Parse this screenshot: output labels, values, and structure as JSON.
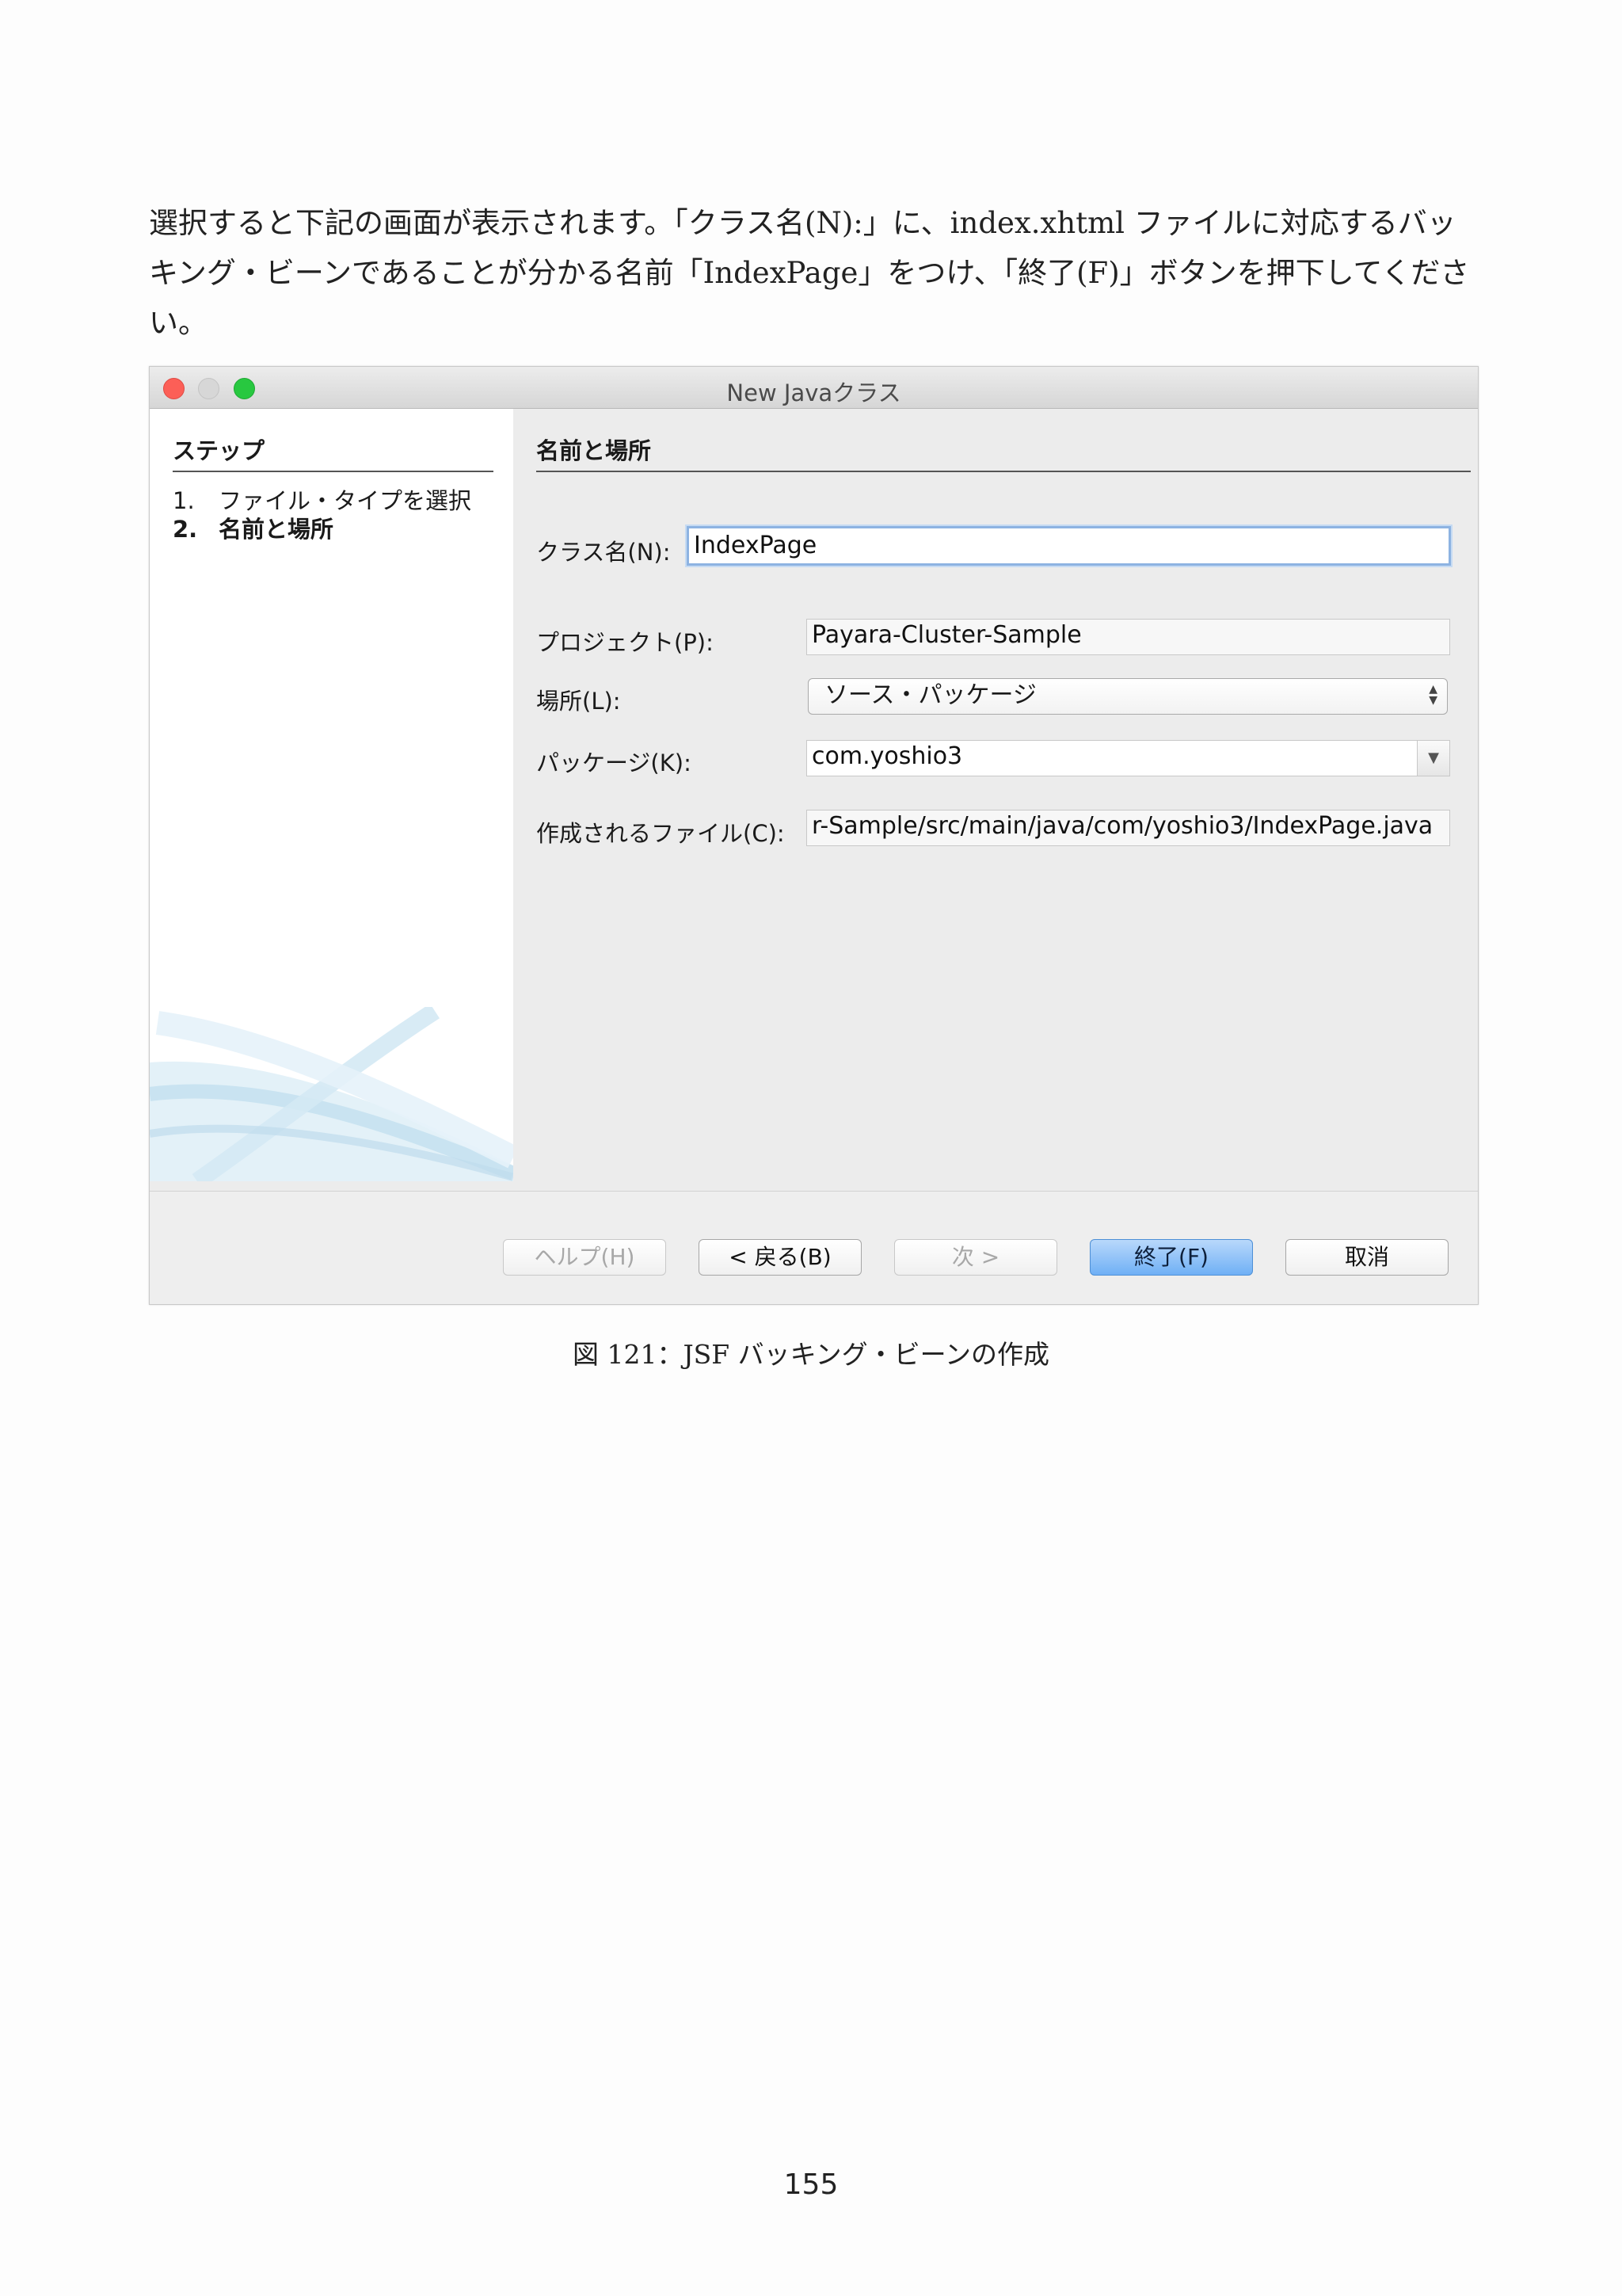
{
  "document": {
    "intro_line1": "選択すると下記の画面が表示されます。「クラス名(N):」に、index.xhtml ファイルに対応するバッ",
    "intro_line2": "キング・ビーンであることが分かる名前「IndexPage」をつけ、「終了(F)」ボタンを押下してください。",
    "caption": "図 121：JSF バッキング・ビーンの作成",
    "page_number": "155"
  },
  "dialog": {
    "title": "New Javaクラス",
    "steps": {
      "heading": "ステップ",
      "items": [
        {
          "num": "1.",
          "label": "ファイル・タイプを選択"
        },
        {
          "num": "2.",
          "label": "名前と場所"
        }
      ]
    },
    "section_heading": "名前と場所",
    "class_name": {
      "label": "クラス名(N):",
      "value": "IndexPage"
    },
    "project": {
      "label": "プロジェクト(P):",
      "value": "Payara-Cluster-Sample"
    },
    "location": {
      "label": "場所(L):",
      "value": "ソース・パッケージ"
    },
    "package": {
      "label": "パッケージ(K):",
      "value": "com.yoshio3"
    },
    "created_file": {
      "label": "作成されるファイル(C):",
      "value": "r-Sample/src/main/java/com/yoshio3/IndexPage.java"
    },
    "buttons": {
      "help": "ヘルプ(H)",
      "back": "< 戻る(B)",
      "next": "次 >",
      "finish": "終了(F)",
      "cancel": "取消"
    },
    "colors": {
      "close": "#fc5f57",
      "minimize": "#d7d7d7",
      "maximize": "#28c840",
      "default_button": "#6fb0f5",
      "focus_ring": "#8db3e2"
    }
  }
}
